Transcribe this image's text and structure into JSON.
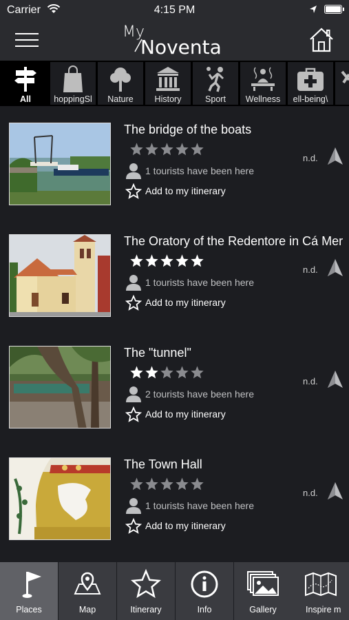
{
  "status_bar": {
    "carrier": "Carrier",
    "time": "4:15 PM"
  },
  "header": {
    "logo_my": "My",
    "logo_name": "Noventa"
  },
  "categories": [
    {
      "label": "All",
      "icon": "signpost-icon"
    },
    {
      "label": "hoppingSl",
      "icon": "shopping-bag-icon"
    },
    {
      "label": "Nature",
      "icon": "tree-icon"
    },
    {
      "label": "History",
      "icon": "museum-icon"
    },
    {
      "label": "Sport",
      "icon": "athlete-icon"
    },
    {
      "label": "Wellness",
      "icon": "spa-icon"
    },
    {
      "label": "ell-being\\",
      "icon": "first-aid-kit-icon"
    }
  ],
  "places": [
    {
      "title": "The bridge of the boats",
      "rating": 0,
      "tourists": "1 tourists have been here",
      "itinerary": "Add to my itinerary",
      "distance": "n.d."
    },
    {
      "title": "The Oratory of the Redentore in Cá Mer",
      "rating": 5,
      "tourists": "1 tourists have been here",
      "itinerary": "Add to my itinerary",
      "distance": "n.d."
    },
    {
      "title": "The \"tunnel\"",
      "rating": 2,
      "tourists": "2 tourists have been here",
      "itinerary": "Add to my itinerary",
      "distance": "n.d."
    },
    {
      "title": "The Town Hall",
      "rating": 0,
      "tourists": "1 tourists have been here",
      "itinerary": "Add to my itinerary",
      "distance": "n.d."
    }
  ],
  "tabs": [
    {
      "label": "Places",
      "icon": "flag-icon"
    },
    {
      "label": "Map",
      "icon": "map-pin-icon"
    },
    {
      "label": "Itinerary",
      "icon": "star-icon"
    },
    {
      "label": "Info",
      "icon": "info-icon"
    },
    {
      "label": "Gallery",
      "icon": "photos-icon"
    },
    {
      "label": "Inspire m",
      "icon": "folded-map-icon"
    }
  ],
  "colors": {
    "background": "#1c1d21",
    "bar": "#2a2b2f",
    "star_filled": "#ffffff",
    "star_empty": "#8a8b8f"
  }
}
